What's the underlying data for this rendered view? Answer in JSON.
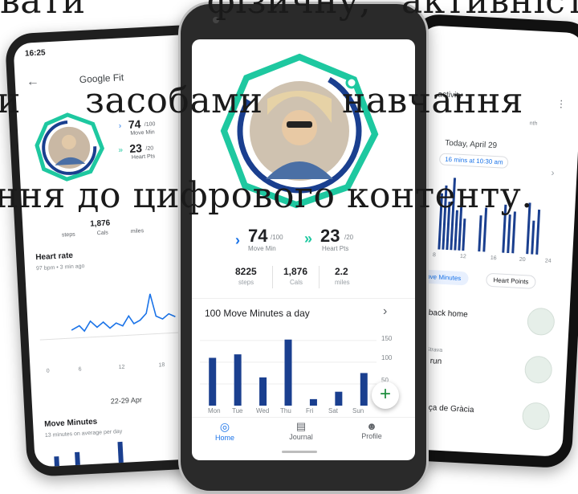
{
  "overlay_text": {
    "line1_left": "вати",
    "line1_mid": "фізичну,",
    "line1_right": "активність",
    "line2_left": "и",
    "line2_mid": "засобами",
    "line2_right": "навчання",
    "line3": "ння до цифрового контенту."
  },
  "left_phone": {
    "status_time": "16:25",
    "app_title": "Google Fit",
    "move_min_value": "74",
    "move_min_max": "/100",
    "move_min_label": "Move Min",
    "heart_pts_value": "23",
    "heart_pts_max": "/20",
    "heart_pts_label": "Heart Pts",
    "steps_label": "steps",
    "cals_value": "1,876",
    "cals_label": "Cals",
    "miles_label": "miles",
    "heart_rate_title": "Heart rate",
    "heart_rate_sub": "97 bpm • 3 min ago",
    "x_ticks": [
      "0",
      "6",
      "12",
      "18"
    ],
    "date_range": "22-29 Apr",
    "move_minutes_title": "Move Minutes",
    "move_minutes_sub": "13 minutes on average per day"
  },
  "center_phone": {
    "move_min_value": "74",
    "move_min_max": "/100",
    "move_min_label": "Move Min",
    "heart_pts_value": "23",
    "heart_pts_max": "/20",
    "heart_pts_label": "Heart Pts",
    "steps_value": "8225",
    "steps_label": "steps",
    "cals_value": "1,876",
    "cals_label": "Cals",
    "miles_value": "2.2",
    "miles_label": "miles",
    "goal_title": "100 Move Minutes a day",
    "chart_ticks": [
      "150",
      "100",
      "50"
    ],
    "days": [
      "Mon",
      "Tue",
      "Wed",
      "Thu",
      "Fri",
      "Sat",
      "Sun"
    ],
    "nav": {
      "home": "Home",
      "journal": "Journal",
      "profile": "Profile"
    },
    "accent_color": "#1a73e8",
    "ring_color": "#1ec8a0"
  },
  "right_phone": {
    "title_fragment": "activity",
    "month_fragment": "nth",
    "date_label": "Today, April 29",
    "pill_text": "16 mins at 10:30 am",
    "x_ticks": [
      "8",
      "12",
      "16",
      "20",
      "24"
    ],
    "chip_move": "Move Minutes",
    "chip_heart": "Heart Points",
    "item1_title": "ute back home",
    "item2_meta": "pm • Strava",
    "item2_title": "time run",
    "item3_meta": "am",
    "item3_title": "o Plaça de Gràcia"
  },
  "chart_data": {
    "type": "bar",
    "categories": [
      "Mon",
      "Tue",
      "Wed",
      "Thu",
      "Fri",
      "Sat",
      "Sun"
    ],
    "values": [
      110,
      118,
      65,
      152,
      15,
      32,
      75
    ],
    "ylim": [
      0,
      170
    ],
    "yticks": [
      50,
      100,
      150
    ],
    "title": "100 Move Minutes a day"
  }
}
